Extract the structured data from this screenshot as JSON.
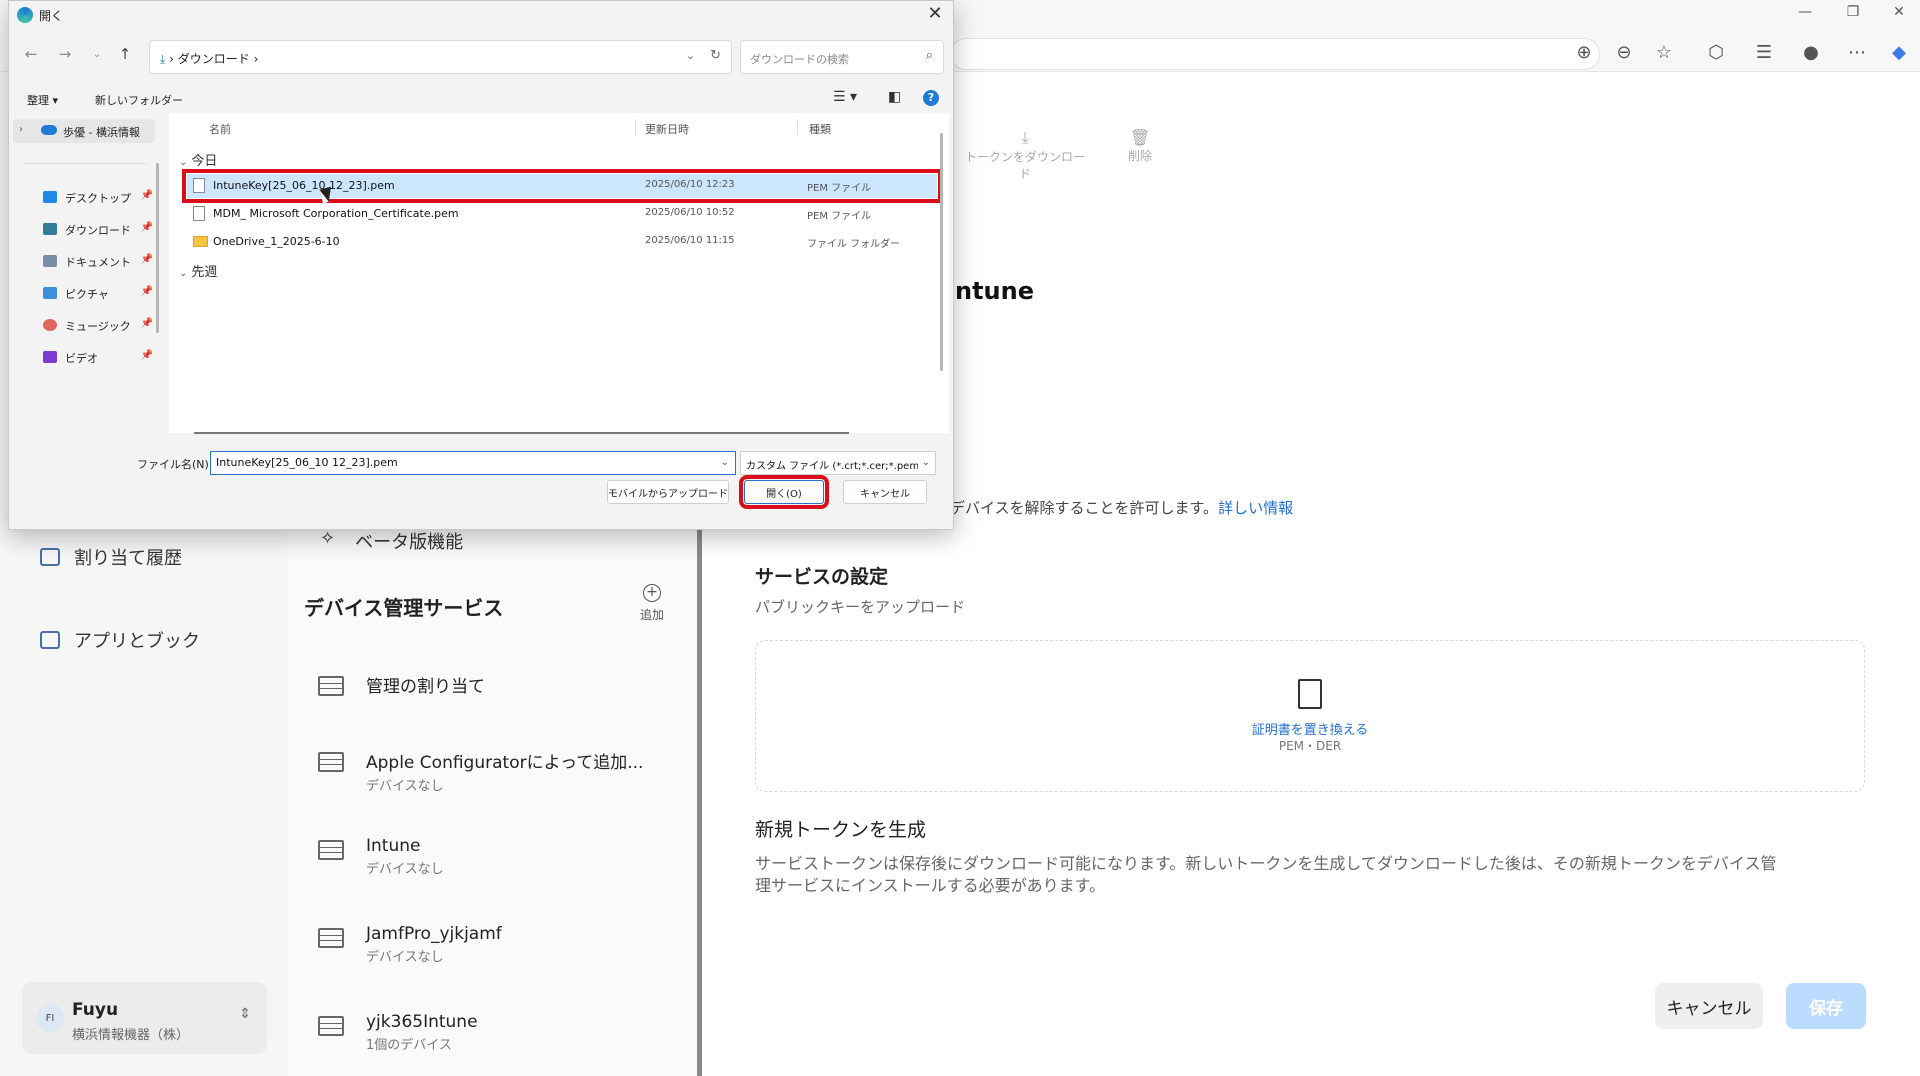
{
  "browser": {
    "window_controls": [
      "—",
      "❐",
      "✕"
    ]
  },
  "dialog": {
    "title": "開く",
    "path": "ダウンロード",
    "search_placeholder": "ダウンロードの検索",
    "organize": "整理 ▾",
    "new_folder": "新しいフォルダー",
    "nav": {
      "onedrive": "歩優 - 横浜情報",
      "quick_access": [
        {
          "label": "デスクトップ",
          "color": "#1e88e5"
        },
        {
          "label": "ダウンロード",
          "color": "#2e7d9a"
        },
        {
          "label": "ドキュメント",
          "color": "#7b8ca8"
        },
        {
          "label": "ピクチャ",
          "color": "#3d8fd6"
        },
        {
          "label": "ミュージック",
          "color": "#e0675a"
        },
        {
          "label": "ビデオ",
          "color": "#7e3bd0"
        }
      ]
    },
    "columns": {
      "name": "名前",
      "date": "更新日時",
      "type": "種類"
    },
    "groups": {
      "today": "今日",
      "last_week": "先週"
    },
    "files": [
      {
        "name": "IntuneKey[25_06_10 12_23].pem",
        "date": "2025/06/10 12:23",
        "type": "PEM ファイル",
        "kind": "file"
      },
      {
        "name": "MDM_ Microsoft Corporation_Certificate.pem",
        "date": "2025/06/10 10:52",
        "type": "PEM ファイル",
        "kind": "file"
      },
      {
        "name": "OneDrive_1_2025-6-10",
        "date": "2025/06/10 11:15",
        "type": "ファイル フォルダー",
        "kind": "folder"
      }
    ],
    "filename_label": "ファイル名(N):",
    "filename_value": "IntuneKey[25_06_10 12_23].pem",
    "filetype_value": "カスタム ファイル (*.crt;*.cer;*.pem;",
    "upload_from_mobile": "モバイルからアップロード",
    "open_button": "開く(O)",
    "cancel_button": "キャンセル"
  },
  "app": {
    "top_actions": {
      "download_token": "トークンをダウンロード",
      "delete": "削除"
    },
    "nav": {
      "history": "割り当て履歴",
      "apps": "アプリとブック"
    },
    "beta": "ベータ版機能",
    "device_services_title": "デバイス管理サービス",
    "add": "追加",
    "services": [
      {
        "name": "管理の割り当て",
        "sub": ""
      },
      {
        "name": "Apple Configuratorによって追加...",
        "sub": "デバイスなし"
      },
      {
        "name": "Intune",
        "sub": "デバイスなし"
      },
      {
        "name": "JamfPro_yjkjamf",
        "sub": "デバイスなし"
      },
      {
        "name": "yjk365Intune",
        "sub": "1個のデバイス"
      }
    ],
    "user": {
      "initials": "FI",
      "name": "Fuyu",
      "org": "横浜情報機器（株）"
    },
    "right": {
      "title_fragment": "ntune",
      "allow_text": "デバイスを解除することを許可します。",
      "more_info": "詳しい情報",
      "service_settings": "サービスの設定",
      "upload_pubkey": "パブリックキーをアップロード",
      "replace_cert": "証明書を置き換える",
      "formats": "PEM・DER",
      "new_token_title": "新規トークンを生成",
      "new_token_desc_1": "サービストークンは保存後にダウンロード可能になります。新しいトークンを生成してダウンロードした後は、その新規トークンをデバイス管",
      "new_token_desc_2": "理サービスにインストールする必要があります。",
      "cancel": "キャンセル",
      "save": "保存"
    }
  }
}
